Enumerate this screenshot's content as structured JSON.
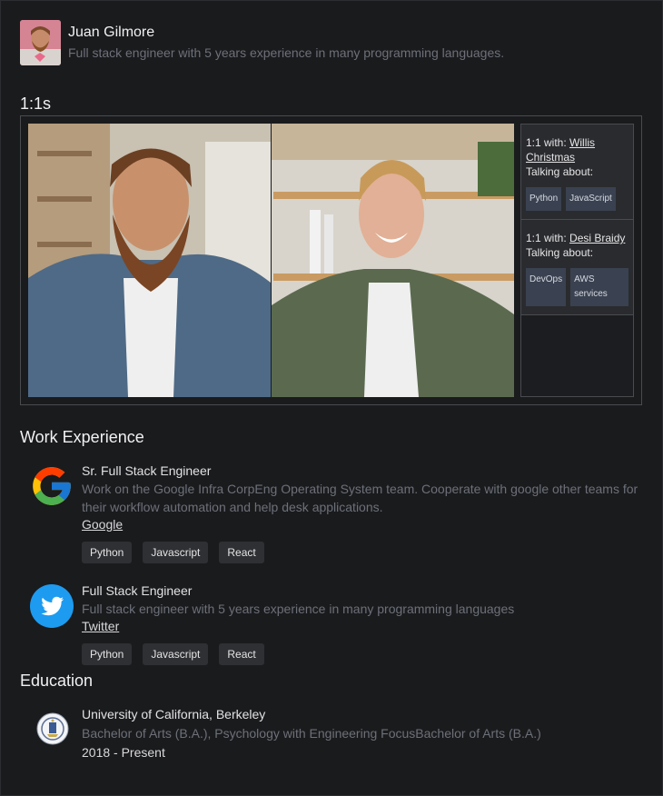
{
  "profile": {
    "name": "Juan Gilmore",
    "bio": "Full stack engineer with 5 years experience in many programming languages."
  },
  "one_on_ones": {
    "title": "1:1s",
    "meetings": [
      {
        "prefix": "1:1 with: ",
        "person": "Willis Christmas",
        "talking_label": "Talking about:",
        "topics": [
          "Python",
          "JavaScript"
        ]
      },
      {
        "prefix": "1:1 with: ",
        "person": "Desi Braidy",
        "talking_label": "Talking about:",
        "topics": [
          "DevOps",
          "AWS services"
        ]
      }
    ]
  },
  "work": {
    "title": "Work Experience",
    "jobs": [
      {
        "logo_icon": "google-logo-icon",
        "title": "Sr. Full Stack Engineer",
        "description": "Work on the Google Infra CorpEng Operating System team. Cooperate with google other teams for their workflow automation and help desk applications.",
        "company": "Google",
        "skills": [
          "Python",
          "Javascript",
          "React"
        ]
      },
      {
        "logo_icon": "twitter-logo-icon",
        "title": "Full Stack Engineer",
        "description": "Full stack engineer with 5 years experience in many programming languages",
        "company": "Twitter",
        "skills": [
          "Python",
          "Javascript",
          "React"
        ]
      }
    ]
  },
  "education": {
    "title": "Education",
    "items": [
      {
        "logo_icon": "university-seal-icon",
        "school": "University of California, Berkeley",
        "degree": "Bachelor of Arts (B.A.), Psychology with Engineering FocusBachelor of Arts (B.A.)",
        "years": "2018 - Present"
      }
    ]
  },
  "colors": {
    "background": "#1a1b1d",
    "muted_text": "#6d7079",
    "topic_chip": "#3a4150",
    "tag_chip": "#2f3033",
    "twitter_blue": "#1d9bf0"
  }
}
